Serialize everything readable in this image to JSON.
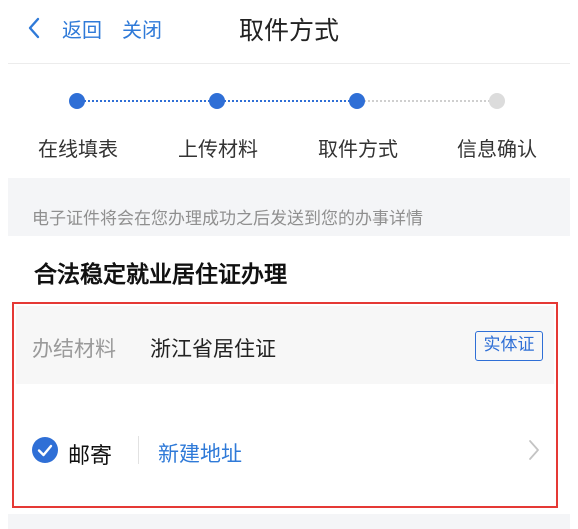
{
  "nav": {
    "back_label": "返回",
    "close_label": "关闭",
    "title": "取件方式"
  },
  "steps": [
    {
      "label": "在线填表",
      "status": "done"
    },
    {
      "label": "上传材料",
      "status": "done"
    },
    {
      "label": "取件方式",
      "status": "current"
    },
    {
      "label": "信息确认",
      "status": "pending"
    }
  ],
  "notice": "电子证件将会在您办理成功之后发送到您的办事详情",
  "section_title": "合法稳定就业居住证办理",
  "material": {
    "label": "办结材料",
    "value": "浙江省居住证",
    "badge": "实体证"
  },
  "delivery": {
    "option_label": "邮寄",
    "checked": true,
    "new_address_label": "新建地址"
  },
  "colors": {
    "accent": "#2f6fd6",
    "link": "#2f7ad8",
    "highlight_border": "#e53935",
    "inactive_dot": "#dcdcdc"
  }
}
